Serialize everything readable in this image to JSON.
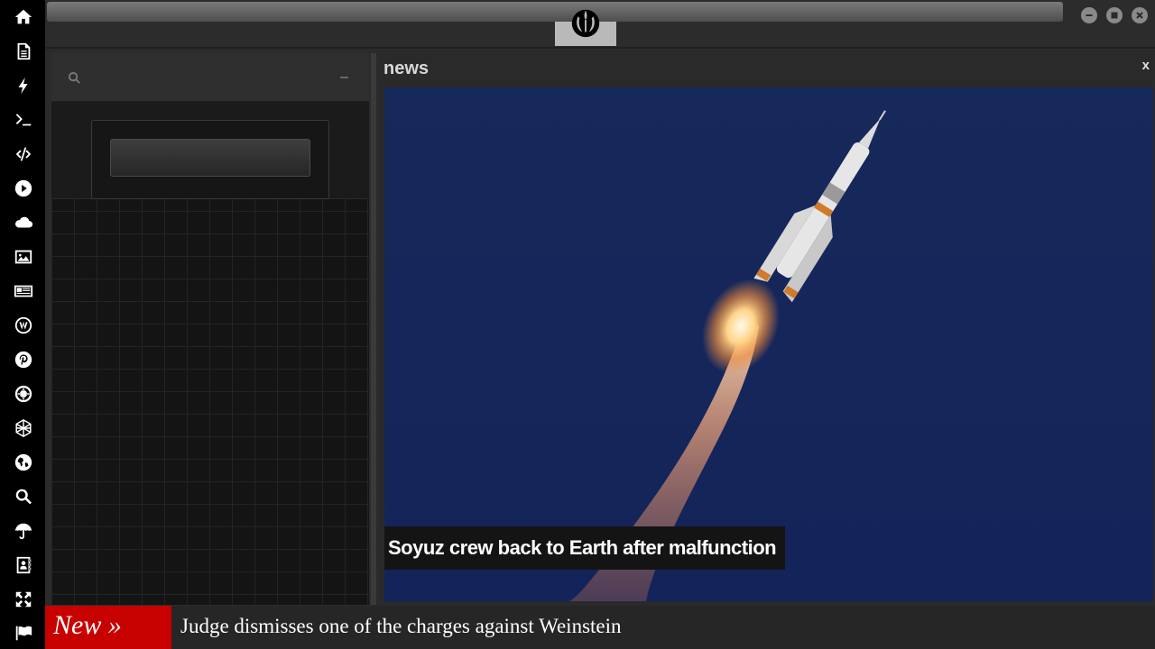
{
  "rail": {
    "icons": [
      "home-icon",
      "document-icon",
      "lightning-icon",
      "terminal-icon",
      "code-icon",
      "play-icon",
      "cloud-icon",
      "image-icon",
      "newspaper-icon",
      "wordpress-icon",
      "pinterest-icon",
      "empire-icon",
      "sphere-icon",
      "globe-icon",
      "search-icon",
      "umbrella-icon",
      "contacts-icon",
      "expand-icon",
      "flag-icon"
    ]
  },
  "left_panel": {
    "search_placeholder": "",
    "collapse_label": "–"
  },
  "news": {
    "title": "news",
    "close_label": "x",
    "headline": "Soyuz crew back to Earth after malfunction"
  },
  "ticker": {
    "tag": "New »",
    "headline": "Judge dismisses one of the charges against Weinstein"
  },
  "colors": {
    "rail_bg": "#000000",
    "ticker_tag": "#c70000",
    "sky": "#14285a"
  }
}
